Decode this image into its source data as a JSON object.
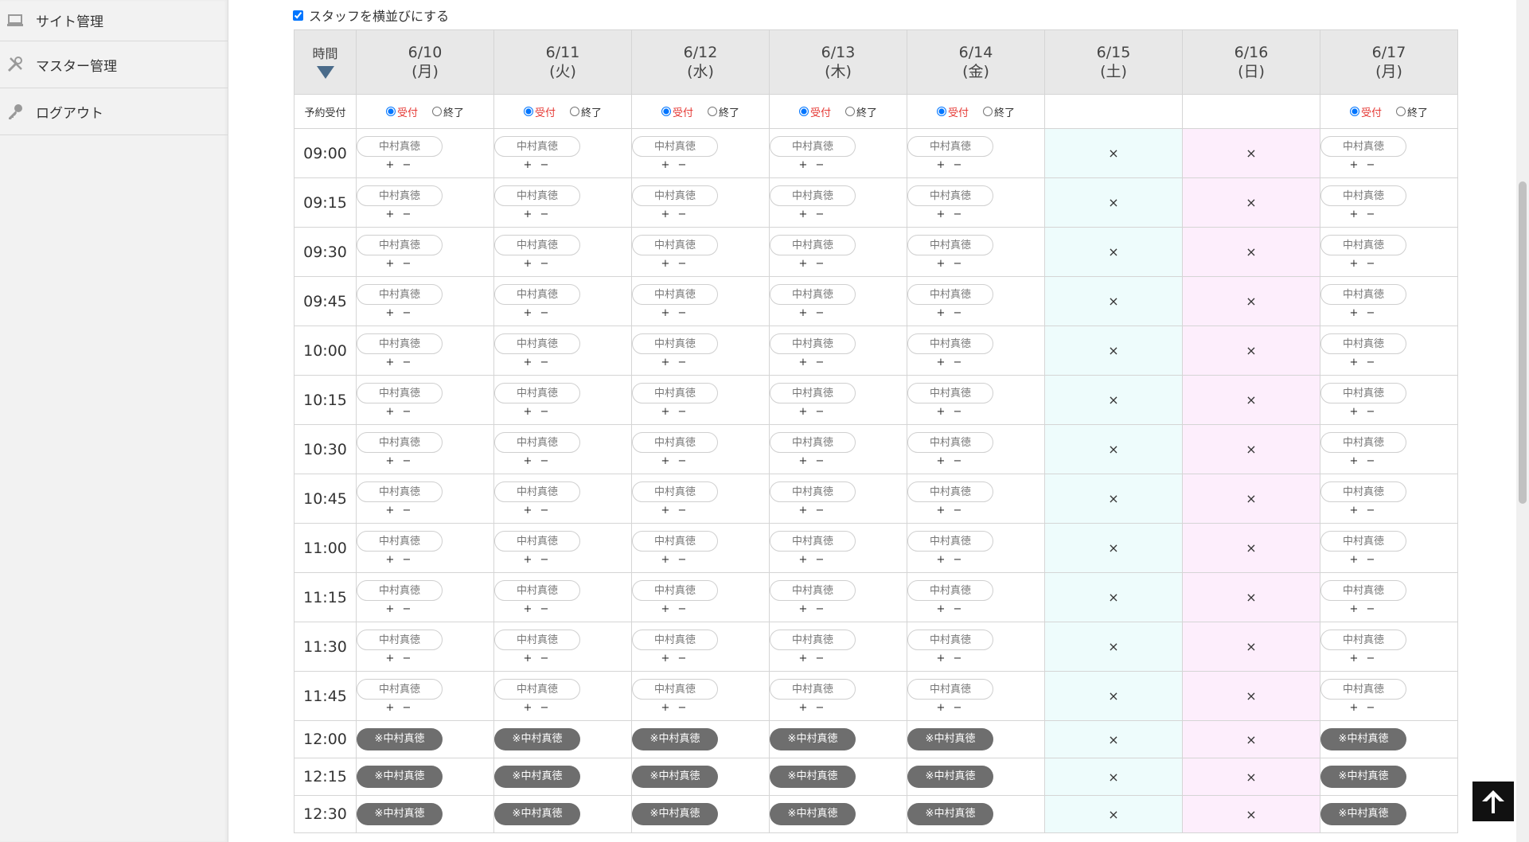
{
  "sidebar": {
    "items": [
      {
        "label": "サイト管理",
        "icon": "laptop-icon"
      },
      {
        "label": "マスター管理",
        "icon": "tools-icon"
      },
      {
        "label": "ログアウト",
        "icon": "key-icon"
      }
    ]
  },
  "options": {
    "stack_staff_label": "スタッフを横並びにする",
    "stack_staff_checked": true
  },
  "table": {
    "time_header": "時間",
    "accept_row_label": "予約受付",
    "accept_on_label": "受付",
    "accept_off_label": "終了",
    "staff_name": "中村真徳",
    "staff_name_booked": "※中村真徳",
    "plus_minus": "+ −",
    "closed_mark": "×",
    "days": [
      {
        "date": "6/10",
        "weekday": "(月)",
        "type": "weekday"
      },
      {
        "date": "6/11",
        "weekday": "(火)",
        "type": "weekday"
      },
      {
        "date": "6/12",
        "weekday": "(水)",
        "type": "weekday"
      },
      {
        "date": "6/13",
        "weekday": "(木)",
        "type": "weekday"
      },
      {
        "date": "6/14",
        "weekday": "(金)",
        "type": "weekday"
      },
      {
        "date": "6/15",
        "weekday": "(土)",
        "type": "sat"
      },
      {
        "date": "6/16",
        "weekday": "(日)",
        "type": "sun"
      },
      {
        "date": "6/17",
        "weekday": "(月)",
        "type": "weekday"
      }
    ],
    "slots": [
      {
        "time": "09:00",
        "booked": false
      },
      {
        "time": "09:15",
        "booked": false
      },
      {
        "time": "09:30",
        "booked": false
      },
      {
        "time": "09:45",
        "booked": false
      },
      {
        "time": "10:00",
        "booked": false
      },
      {
        "time": "10:15",
        "booked": false
      },
      {
        "time": "10:30",
        "booked": false
      },
      {
        "time": "10:45",
        "booked": false
      },
      {
        "time": "11:00",
        "booked": false
      },
      {
        "time": "11:15",
        "booked": false
      },
      {
        "time": "11:30",
        "booked": false
      },
      {
        "time": "11:45",
        "booked": false
      },
      {
        "time": "12:00",
        "booked": true
      },
      {
        "time": "12:15",
        "booked": true
      },
      {
        "time": "12:30",
        "booked": true
      }
    ]
  }
}
